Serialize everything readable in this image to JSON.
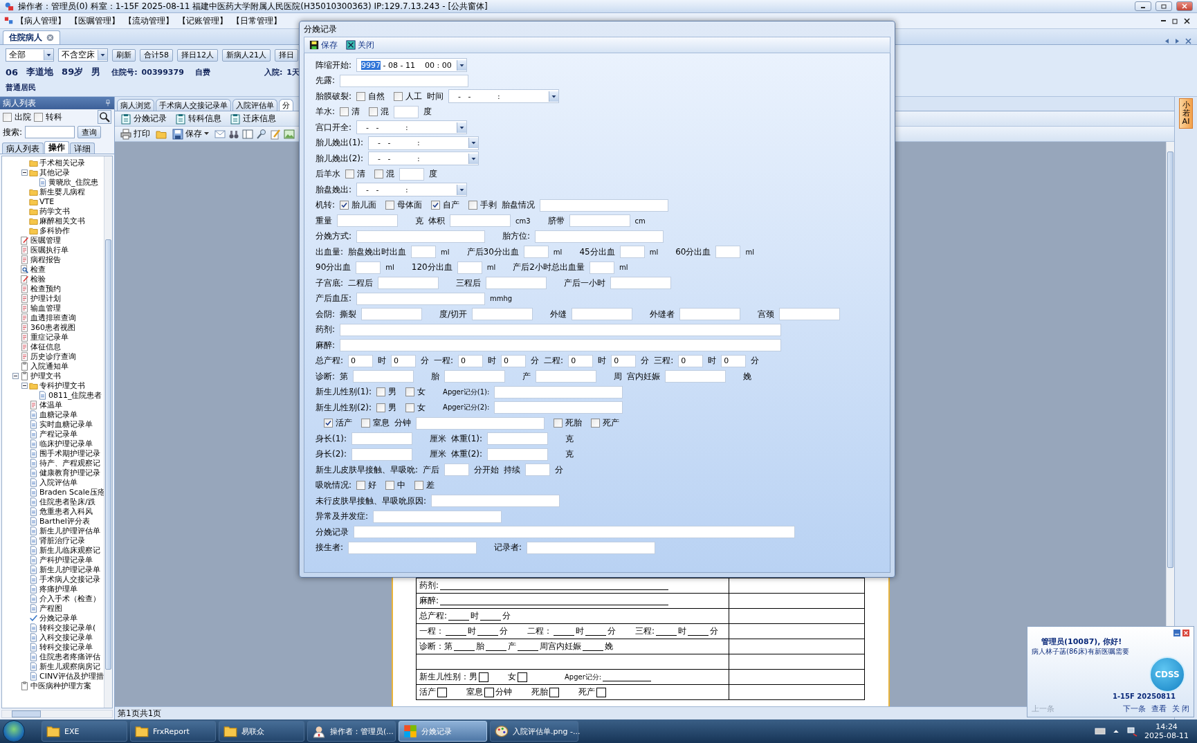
{
  "window": {
    "title": "操作者：管理员(0)  科室：1-15F  2025-08-11  福建中医药大学附属人民医院(H35010300363) IP:129.7.13.243 - [公共窗体]"
  },
  "menu": [
    "【病人管理】",
    "【医嘱管理】",
    "【流动管理】",
    "【记账管理】",
    "【日常管理】"
  ],
  "doc_tabs": [
    {
      "label": "住院病人",
      "selected": true
    }
  ],
  "filters": {
    "range": "全部",
    "bed": "不含空床",
    "buttons": [
      "刷新",
      "合计58",
      "择日12人",
      "新病人21人",
      "择日"
    ]
  },
  "patient": {
    "bed": "06",
    "name": "李道地",
    "age": "89岁",
    "sex": "男",
    "id_label": "住院号:",
    "id": "00399379",
    "pay": "自费",
    "admit_label": "入院:",
    "admit": "1天",
    "category": "普通居民"
  },
  "left_panel": {
    "title": "病人列表",
    "checks": [
      {
        "label": "出院",
        "checked": false
      },
      {
        "label": "转科",
        "checked": false
      }
    ],
    "search_label": "搜索:",
    "search_button": "查询",
    "tabs": [
      {
        "label": "病人列表",
        "selected": false
      },
      {
        "label": "操作",
        "selected": true
      },
      {
        "label": "详细",
        "selected": false
      }
    ],
    "tree_scrolled": [
      {
        "label": "手术相关记录",
        "kind": "folder"
      },
      {
        "label": "其他记录",
        "kind": "folder",
        "expanded": true,
        "children": [
          {
            "label": "黄晓欣_住院患",
            "kind": "doc"
          }
        ]
      },
      {
        "label": "新生婴儿病程",
        "kind": "folder"
      },
      {
        "label": "VTE",
        "kind": "folder"
      },
      {
        "label": "药学文书",
        "kind": "folder"
      },
      {
        "label": "麻醉相关文书",
        "kind": "folder"
      },
      {
        "label": "多科协作",
        "kind": "folder"
      }
    ],
    "tree": [
      {
        "label": "医嘱管理",
        "kind": "edit"
      },
      {
        "label": "医嘱执行单",
        "kind": "form"
      },
      {
        "label": "病程报告",
        "kind": "form"
      },
      {
        "label": "检查",
        "kind": "search"
      },
      {
        "label": "检验",
        "kind": "edit"
      },
      {
        "label": "检查预约",
        "kind": "form"
      },
      {
        "label": "护理计划",
        "kind": "form"
      },
      {
        "label": "输血管理",
        "kind": "form"
      },
      {
        "label": "血透排班查询",
        "kind": "form"
      },
      {
        "label": "360患者视图",
        "kind": "form"
      },
      {
        "label": "重症记录单",
        "kind": "form"
      },
      {
        "label": "体征信息",
        "kind": "form"
      },
      {
        "label": "历史诊疗查询",
        "kind": "form"
      },
      {
        "label": "入院通知单",
        "kind": "clip"
      },
      {
        "label": "护理文书",
        "kind": "clip",
        "expanded": true,
        "children": [
          {
            "label": "专科护理文书",
            "kind": "folder",
            "expanded": true,
            "children": [
              {
                "label": "0811_住院患者",
                "kind": "doc"
              }
            ]
          },
          {
            "label": "体温单",
            "kind": "form"
          },
          {
            "label": "血糖记录单",
            "kind": "doc"
          },
          {
            "label": "实时血糖记录单",
            "kind": "doc"
          },
          {
            "label": "产程记录单",
            "kind": "doc"
          },
          {
            "label": "临床护理记录单",
            "kind": "doc"
          },
          {
            "label": "围手术期护理记录",
            "kind": "doc"
          },
          {
            "label": "待产、产程观察记",
            "kind": "doc"
          },
          {
            "label": "健康教育护理记录",
            "kind": "doc"
          },
          {
            "label": "入院评估单",
            "kind": "doc"
          },
          {
            "label": "Braden Scale压疮",
            "kind": "doc"
          },
          {
            "label": "住院患者坠床/跌",
            "kind": "doc"
          },
          {
            "label": "危重患者入科风",
            "kind": "doc"
          },
          {
            "label": "Barthel评分表",
            "kind": "doc"
          },
          {
            "label": "新生儿护理评估单",
            "kind": "doc"
          },
          {
            "label": "肾脏治疗记录",
            "kind": "doc"
          },
          {
            "label": "新生儿临床观察记",
            "kind": "doc"
          },
          {
            "label": "产科护理记录单",
            "kind": "doc"
          },
          {
            "label": "新生儿护理记录单",
            "kind": "doc"
          },
          {
            "label": "手术病人交接记录",
            "kind": "doc"
          },
          {
            "label": "疼痛护理单",
            "kind": "doc"
          },
          {
            "label": "介入手术（检查）",
            "kind": "doc"
          },
          {
            "label": "产程图",
            "kind": "doc"
          },
          {
            "label": "分娩记录单",
            "kind": "check"
          },
          {
            "label": "转科交接记录单(",
            "kind": "doc"
          },
          {
            "label": "入科交接记录单",
            "kind": "doc"
          },
          {
            "label": "转科交接记录单",
            "kind": "doc"
          },
          {
            "label": "住院患者疼痛评估",
            "kind": "doc"
          },
          {
            "label": "新生儿观察病房记",
            "kind": "doc"
          },
          {
            "label": "CINV评估及护理措",
            "kind": "doc"
          }
        ]
      },
      {
        "label": "中医病种护理方案",
        "kind": "clip"
      }
    ]
  },
  "center": {
    "tabs": [
      {
        "label": "病人浏览",
        "selected": false
      },
      {
        "label": "手术病人交接记录单",
        "selected": false
      },
      {
        "label": "入院评估单",
        "selected": false
      },
      {
        "label": "分",
        "selected": true
      }
    ],
    "records": [
      "分娩记录",
      "转科信息",
      "迁床信息"
    ],
    "print": "打印",
    "save": "保存",
    "document": [
      {
        "kind": "text",
        "items": [
          {
            "kind": "text",
            "text": "药剂:"
          },
          {
            "kind": "longline"
          }
        ]
      },
      {
        "kind": "text",
        "items": [
          {
            "kind": "text",
            "text": "麻醉:"
          },
          {
            "kind": "longline"
          }
        ]
      },
      {
        "kind": "text",
        "items": [
          {
            "kind": "text",
            "text": "总产程:"
          },
          {
            "kind": "line"
          },
          {
            "kind": "text",
            "text": "时"
          },
          {
            "kind": "line"
          },
          {
            "kind": "text",
            "text": "分"
          }
        ]
      },
      {
        "kind": "text",
        "items": [
          {
            "kind": "text",
            "text": "一程："
          },
          {
            "kind": "line"
          },
          {
            "kind": "text",
            "text": "时"
          },
          {
            "kind": "line"
          },
          {
            "kind": "text",
            "text": "分"
          },
          {
            "kind": "gap"
          },
          {
            "kind": "text",
            "text": "二程："
          },
          {
            "kind": "line"
          },
          {
            "kind": "text",
            "text": "时"
          },
          {
            "kind": "line"
          },
          {
            "kind": "text",
            "text": "分"
          },
          {
            "kind": "gap"
          },
          {
            "kind": "text",
            "text": "三程:"
          },
          {
            "kind": "line"
          },
          {
            "kind": "text",
            "text": "时"
          },
          {
            "kind": "line"
          },
          {
            "kind": "text",
            "text": "分"
          }
        ]
      },
      {
        "kind": "text",
        "items": [
          {
            "kind": "text",
            "text": "诊断：第"
          },
          {
            "kind": "line"
          },
          {
            "kind": "text",
            "text": "胎"
          },
          {
            "kind": "line"
          },
          {
            "kind": "text",
            "text": "产"
          },
          {
            "kind": "line"
          },
          {
            "kind": "text",
            "text": "周宫内妊娠"
          },
          {
            "kind": "line"
          },
          {
            "kind": "text",
            "text": "娩"
          }
        ]
      },
      {
        "kind": "blank"
      },
      {
        "kind": "text",
        "items": [
          {
            "kind": "text",
            "text": "新生儿性别：男"
          },
          {
            "kind": "box",
            "checked": false
          },
          {
            "kind": "gap"
          },
          {
            "kind": "text",
            "text": "女"
          },
          {
            "kind": "box",
            "checked": false
          },
          {
            "kind": "gap"
          },
          {
            "kind": "gap"
          },
          {
            "kind": "small",
            "text": "Apger记分:"
          },
          {
            "kind": "midline"
          }
        ]
      },
      {
        "kind": "text",
        "items": [
          {
            "kind": "text",
            "text": "活产"
          },
          {
            "kind": "box",
            "checked": false
          },
          {
            "kind": "gap"
          },
          {
            "kind": "text",
            "text": "室息"
          },
          {
            "kind": "box",
            "checked": false
          },
          {
            "kind": "text",
            "text": "分钟"
          },
          {
            "kind": "gap"
          },
          {
            "kind": "text",
            "text": "死胎"
          },
          {
            "kind": "box",
            "checked": false
          },
          {
            "kind": "gap"
          },
          {
            "kind": "text",
            "text": "死产"
          },
          {
            "kind": "box",
            "checked": false
          }
        ]
      }
    ],
    "status": "第1页共1页"
  },
  "assistant_tab": "小若AI",
  "dialog": {
    "title": "分娩记录",
    "actions": [
      {
        "label": "保存",
        "kind": "save"
      },
      {
        "label": "关闭",
        "kind": "close"
      }
    ],
    "rows": [
      {
        "items": [
          {
            "kind": "label",
            "text": "阵缩开始:"
          },
          {
            "kind": "date",
            "highlight": "9997",
            "value": " - 08 - 11    00 : 00"
          }
        ]
      },
      {
        "items": [
          {
            "kind": "label",
            "text": "先露:"
          },
          {
            "kind": "long"
          }
        ]
      },
      {
        "items": [
          {
            "kind": "label",
            "text": "胎膜破裂:"
          },
          {
            "kind": "check",
            "label": "自然",
            "checked": false
          },
          {
            "kind": "check",
            "label": "人工",
            "checked": false
          },
          {
            "kind": "label",
            "text": "时间"
          },
          {
            "kind": "date",
            "value": "  -   -           :"
          }
        ]
      },
      {
        "items": [
          {
            "kind": "label",
            "text": "羊水:"
          },
          {
            "kind": "check",
            "label": "清",
            "checked": false
          },
          {
            "kind": "check",
            "label": "混",
            "checked": false
          },
          {
            "kind": "box"
          },
          {
            "kind": "label",
            "text": "度"
          }
        ]
      },
      {
        "items": [
          {
            "kind": "label",
            "text": "宫口开全:"
          },
          {
            "kind": "date",
            "value": "  -   -           :"
          }
        ]
      },
      {
        "items": [
          {
            "kind": "label",
            "text": "胎儿娩出(1):"
          },
          {
            "kind": "date",
            "value": "  -   -           :"
          }
        ]
      },
      {
        "items": [
          {
            "kind": "label",
            "text": "胎儿娩出(2):"
          },
          {
            "kind": "date",
            "value": "  -   -           :"
          }
        ]
      },
      {
        "items": [
          {
            "kind": "label",
            "text": "后羊水"
          },
          {
            "kind": "check",
            "label": "清",
            "checked": false
          },
          {
            "kind": "check",
            "label": "混",
            "checked": false
          },
          {
            "kind": "box"
          },
          {
            "kind": "label",
            "text": "度"
          }
        ]
      },
      {
        "items": [
          {
            "kind": "label",
            "text": "胎盘娩出:"
          },
          {
            "kind": "date",
            "value": "  -   -           :"
          }
        ]
      },
      {
        "items": [
          {
            "kind": "label",
            "text": "机转:"
          },
          {
            "kind": "check",
            "label": "胎儿面",
            "checked": true
          },
          {
            "kind": "check",
            "label": "母体面",
            "checked": false
          },
          {
            "kind": "check",
            "label": "自产",
            "checked": true
          },
          {
            "kind": "check",
            "label": "手剥",
            "checked": false
          },
          {
            "kind": "label",
            "text": "胎盘情况"
          },
          {
            "kind": "long"
          }
        ]
      },
      {
        "items": [
          {
            "kind": "label",
            "text": "重量"
          },
          {
            "kind": "field"
          },
          {
            "kind": "label",
            "text": "克"
          },
          {
            "kind": "label",
            "text": "体积"
          },
          {
            "kind": "field"
          },
          {
            "kind": "unit",
            "text": "cm3"
          },
          {
            "kind": "label",
            "text": "脐带"
          },
          {
            "kind": "field"
          },
          {
            "kind": "unit",
            "text": "cm"
          }
        ]
      },
      {
        "items": [
          {
            "kind": "label",
            "text": "分娩方式:"
          },
          {
            "kind": "long"
          },
          {
            "kind": "label",
            "text": "胎方位:"
          },
          {
            "kind": "long"
          }
        ]
      },
      {
        "items": [
          {
            "kind": "label",
            "text": "出血量:"
          },
          {
            "kind": "label",
            "text": "胎盘娩出时出血"
          },
          {
            "kind": "box"
          },
          {
            "kind": "unit",
            "text": "ml"
          },
          {
            "kind": "label",
            "text": "产后30分出血"
          },
          {
            "kind": "box"
          },
          {
            "kind": "unit",
            "text": "ml"
          },
          {
            "kind": "label",
            "text": "45分出血"
          },
          {
            "kind": "box"
          },
          {
            "kind": "unit",
            "text": "ml"
          },
          {
            "kind": "label",
            "text": "60分出血"
          },
          {
            "kind": "box"
          },
          {
            "kind": "unit",
            "text": "ml"
          }
        ]
      },
      {
        "items": [
          {
            "kind": "label",
            "text": "90分出血"
          },
          {
            "kind": "box"
          },
          {
            "kind": "unit",
            "text": "ml"
          },
          {
            "kind": "label",
            "text": "120分出血"
          },
          {
            "kind": "box"
          },
          {
            "kind": "unit",
            "text": "ml"
          },
          {
            "kind": "label",
            "text": "产后2小时总出血量"
          },
          {
            "kind": "box"
          },
          {
            "kind": "unit",
            "text": "ml"
          }
        ]
      },
      {
        "items": [
          {
            "kind": "label",
            "text": "子宫底:"
          },
          {
            "kind": "label",
            "text": "二程后"
          },
          {
            "kind": "field"
          },
          {
            "kind": "label",
            "text": "三程后"
          },
          {
            "kind": "field"
          },
          {
            "kind": "label",
            "text": "产后一小时"
          },
          {
            "kind": "field"
          }
        ]
      },
      {
        "items": [
          {
            "kind": "label",
            "text": "产后血压:"
          },
          {
            "kind": "long"
          },
          {
            "kind": "unit",
            "text": "mmhg"
          }
        ]
      },
      {
        "items": [
          {
            "kind": "label",
            "text": "会阴:"
          },
          {
            "kind": "label",
            "text": "撕裂"
          },
          {
            "kind": "field"
          },
          {
            "kind": "label",
            "text": "度/切开"
          },
          {
            "kind": "field"
          },
          {
            "kind": "label",
            "text": "外缝"
          },
          {
            "kind": "field"
          },
          {
            "kind": "label",
            "text": "外缝者"
          },
          {
            "kind": "field"
          },
          {
            "kind": "label",
            "text": "宫颈"
          },
          {
            "kind": "field"
          }
        ]
      },
      {
        "items": [
          {
            "kind": "label",
            "text": "药剂:"
          },
          {
            "kind": "wide"
          }
        ]
      },
      {
        "items": [
          {
            "kind": "label",
            "text": "麻醉:"
          },
          {
            "kind": "wide"
          }
        ]
      },
      {
        "items": [
          {
            "kind": "label",
            "text": "总产程:"
          },
          {
            "kind": "box",
            "value": "0"
          },
          {
            "kind": "label",
            "text": "时"
          },
          {
            "kind": "box",
            "value": "0"
          },
          {
            "kind": "label",
            "text": "分"
          },
          {
            "kind": "label",
            "text": "一程:"
          },
          {
            "kind": "box",
            "value": "0"
          },
          {
            "kind": "label",
            "text": "时"
          },
          {
            "kind": "box",
            "value": "0"
          },
          {
            "kind": "label",
            "text": "分"
          },
          {
            "kind": "label",
            "text": "二程:"
          },
          {
            "kind": "box",
            "value": "0"
          },
          {
            "kind": "label",
            "text": "时"
          },
          {
            "kind": "box",
            "value": "0"
          },
          {
            "kind": "label",
            "text": "分"
          },
          {
            "kind": "label",
            "text": "三程:"
          },
          {
            "kind": "box",
            "value": "0"
          },
          {
            "kind": "label",
            "text": "时"
          },
          {
            "kind": "box",
            "value": "0"
          },
          {
            "kind": "label",
            "text": "分"
          }
        ]
      },
      {
        "items": [
          {
            "kind": "label",
            "text": "诊断:"
          },
          {
            "kind": "label",
            "text": "第"
          },
          {
            "kind": "field"
          },
          {
            "kind": "label",
            "text": "胎"
          },
          {
            "kind": "field"
          },
          {
            "kind": "label",
            "text": "产"
          },
          {
            "kind": "field"
          },
          {
            "kind": "label",
            "text": "周"
          },
          {
            "kind": "label",
            "text": "宫内妊娠"
          },
          {
            "kind": "field"
          },
          {
            "kind": "label",
            "text": "娩"
          }
        ]
      },
      {
        "items": [
          {
            "kind": "label",
            "text": "新生儿性别(1):"
          },
          {
            "kind": "check",
            "label": "男",
            "checked": false
          },
          {
            "kind": "check",
            "label": "女",
            "checked": false
          },
          {
            "kind": "unit",
            "text": "Apger记分(1):"
          },
          {
            "kind": "long"
          }
        ]
      },
      {
        "items": [
          {
            "kind": "label",
            "text": "新生儿性别(2):"
          },
          {
            "kind": "check",
            "label": "男",
            "checked": false
          },
          {
            "kind": "check",
            "label": "女",
            "checked": false
          },
          {
            "kind": "unit",
            "text": "Apger记分(2):"
          },
          {
            "kind": "long"
          }
        ]
      },
      {
        "items": [
          {
            "kind": "check",
            "label": "活产",
            "checked": true
          },
          {
            "kind": "check",
            "label": "室息",
            "checked": false
          },
          {
            "kind": "label",
            "text": "分钟"
          },
          {
            "kind": "long"
          },
          {
            "kind": "check",
            "label": "死胎",
            "checked": false
          },
          {
            "kind": "check",
            "label": "死产",
            "checked": false
          }
        ]
      },
      {
        "items": [
          {
            "kind": "label",
            "text": "身长(1):"
          },
          {
            "kind": "field"
          },
          {
            "kind": "label",
            "text": "厘米"
          },
          {
            "kind": "label",
            "text": "体重(1):"
          },
          {
            "kind": "field"
          },
          {
            "kind": "label",
            "text": "克"
          }
        ]
      },
      {
        "items": [
          {
            "kind": "label",
            "text": "身长(2):"
          },
          {
            "kind": "field"
          },
          {
            "kind": "label",
            "text": "厘米"
          },
          {
            "kind": "label",
            "text": "体重(2):"
          },
          {
            "kind": "field"
          },
          {
            "kind": "label",
            "text": "克"
          }
        ]
      },
      {
        "items": [
          {
            "kind": "label",
            "text": "新生儿皮肤早接触、早吸吮:"
          },
          {
            "kind": "label",
            "text": "产后"
          },
          {
            "kind": "box"
          },
          {
            "kind": "label",
            "text": "分开始"
          },
          {
            "kind": "label",
            "text": "持续"
          },
          {
            "kind": "box"
          },
          {
            "kind": "label",
            "text": "分"
          }
        ]
      },
      {
        "items": [
          {
            "kind": "label",
            "text": "吸吮情况:"
          },
          {
            "kind": "check",
            "label": "好",
            "checked": false
          },
          {
            "kind": "check",
            "label": "中",
            "checked": false
          },
          {
            "kind": "check",
            "label": "差",
            "checked": false
          }
        ]
      },
      {
        "items": [
          {
            "kind": "label",
            "text": "未行皮肤早接触、早吸吮原因:"
          },
          {
            "kind": "long"
          }
        ]
      },
      {
        "items": [
          {
            "kind": "label",
            "text": "异常及并发症:"
          },
          {
            "kind": "long"
          }
        ]
      },
      {
        "items": [
          {
            "kind": "label",
            "text": "分娩记录"
          },
          {
            "kind": "wide"
          }
        ]
      },
      {
        "items": [
          {
            "kind": "label",
            "text": "接生者:"
          },
          {
            "kind": "long"
          },
          {
            "kind": "label",
            "text": "记录者:"
          },
          {
            "kind": "long"
          }
        ]
      }
    ]
  },
  "notification": {
    "greeting": "管理员(10087), 你好!",
    "message": "病人林子菡(86床)有新医嘱需要",
    "badge": "CDSS",
    "stamp": "1-15F 20250811",
    "links": [
      {
        "label": "上一条",
        "disabled": true
      },
      {
        "label": "下一条",
        "disabled": false
      },
      {
        "label": "查看",
        "disabled": false
      },
      {
        "label": "关 闭",
        "disabled": false
      }
    ]
  },
  "taskbar": {
    "items": [
      {
        "label": "EXE",
        "kind": "folder",
        "selected": false
      },
      {
        "label": "FrxReport",
        "kind": "folder",
        "selected": false
      },
      {
        "label": "易联众",
        "kind": "folder",
        "selected": false
      },
      {
        "label": "操作者：管理员(...",
        "kind": "app",
        "selected": false
      },
      {
        "label": "分娩记录",
        "kind": "window",
        "selected": true
      },
      {
        "label": "入院评估单.png -...",
        "kind": "paint",
        "selected": false
      }
    ],
    "time": "14:24",
    "date": "2025-08-11"
  }
}
